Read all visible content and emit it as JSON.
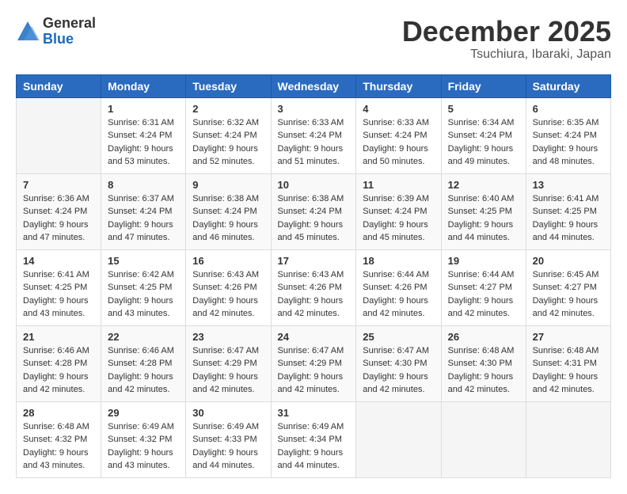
{
  "header": {
    "logo_general": "General",
    "logo_blue": "Blue",
    "month_title": "December 2025",
    "location": "Tsuchiura, Ibaraki, Japan"
  },
  "calendar": {
    "days_of_week": [
      "Sunday",
      "Monday",
      "Tuesday",
      "Wednesday",
      "Thursday",
      "Friday",
      "Saturday"
    ],
    "weeks": [
      [
        {
          "day": "",
          "info": ""
        },
        {
          "day": "1",
          "info": "Sunrise: 6:31 AM\nSunset: 4:24 PM\nDaylight: 9 hours\nand 53 minutes."
        },
        {
          "day": "2",
          "info": "Sunrise: 6:32 AM\nSunset: 4:24 PM\nDaylight: 9 hours\nand 52 minutes."
        },
        {
          "day": "3",
          "info": "Sunrise: 6:33 AM\nSunset: 4:24 PM\nDaylight: 9 hours\nand 51 minutes."
        },
        {
          "day": "4",
          "info": "Sunrise: 6:33 AM\nSunset: 4:24 PM\nDaylight: 9 hours\nand 50 minutes."
        },
        {
          "day": "5",
          "info": "Sunrise: 6:34 AM\nSunset: 4:24 PM\nDaylight: 9 hours\nand 49 minutes."
        },
        {
          "day": "6",
          "info": "Sunrise: 6:35 AM\nSunset: 4:24 PM\nDaylight: 9 hours\nand 48 minutes."
        }
      ],
      [
        {
          "day": "7",
          "info": "Sunrise: 6:36 AM\nSunset: 4:24 PM\nDaylight: 9 hours\nand 47 minutes."
        },
        {
          "day": "8",
          "info": "Sunrise: 6:37 AM\nSunset: 4:24 PM\nDaylight: 9 hours\nand 47 minutes."
        },
        {
          "day": "9",
          "info": "Sunrise: 6:38 AM\nSunset: 4:24 PM\nDaylight: 9 hours\nand 46 minutes."
        },
        {
          "day": "10",
          "info": "Sunrise: 6:38 AM\nSunset: 4:24 PM\nDaylight: 9 hours\nand 45 minutes."
        },
        {
          "day": "11",
          "info": "Sunrise: 6:39 AM\nSunset: 4:24 PM\nDaylight: 9 hours\nand 45 minutes."
        },
        {
          "day": "12",
          "info": "Sunrise: 6:40 AM\nSunset: 4:25 PM\nDaylight: 9 hours\nand 44 minutes."
        },
        {
          "day": "13",
          "info": "Sunrise: 6:41 AM\nSunset: 4:25 PM\nDaylight: 9 hours\nand 44 minutes."
        }
      ],
      [
        {
          "day": "14",
          "info": "Sunrise: 6:41 AM\nSunset: 4:25 PM\nDaylight: 9 hours\nand 43 minutes."
        },
        {
          "day": "15",
          "info": "Sunrise: 6:42 AM\nSunset: 4:25 PM\nDaylight: 9 hours\nand 43 minutes."
        },
        {
          "day": "16",
          "info": "Sunrise: 6:43 AM\nSunset: 4:26 PM\nDaylight: 9 hours\nand 42 minutes."
        },
        {
          "day": "17",
          "info": "Sunrise: 6:43 AM\nSunset: 4:26 PM\nDaylight: 9 hours\nand 42 minutes."
        },
        {
          "day": "18",
          "info": "Sunrise: 6:44 AM\nSunset: 4:26 PM\nDaylight: 9 hours\nand 42 minutes."
        },
        {
          "day": "19",
          "info": "Sunrise: 6:44 AM\nSunset: 4:27 PM\nDaylight: 9 hours\nand 42 minutes."
        },
        {
          "day": "20",
          "info": "Sunrise: 6:45 AM\nSunset: 4:27 PM\nDaylight: 9 hours\nand 42 minutes."
        }
      ],
      [
        {
          "day": "21",
          "info": "Sunrise: 6:46 AM\nSunset: 4:28 PM\nDaylight: 9 hours\nand 42 minutes."
        },
        {
          "day": "22",
          "info": "Sunrise: 6:46 AM\nSunset: 4:28 PM\nDaylight: 9 hours\nand 42 minutes."
        },
        {
          "day": "23",
          "info": "Sunrise: 6:47 AM\nSunset: 4:29 PM\nDaylight: 9 hours\nand 42 minutes."
        },
        {
          "day": "24",
          "info": "Sunrise: 6:47 AM\nSunset: 4:29 PM\nDaylight: 9 hours\nand 42 minutes."
        },
        {
          "day": "25",
          "info": "Sunrise: 6:47 AM\nSunset: 4:30 PM\nDaylight: 9 hours\nand 42 minutes."
        },
        {
          "day": "26",
          "info": "Sunrise: 6:48 AM\nSunset: 4:30 PM\nDaylight: 9 hours\nand 42 minutes."
        },
        {
          "day": "27",
          "info": "Sunrise: 6:48 AM\nSunset: 4:31 PM\nDaylight: 9 hours\nand 42 minutes."
        }
      ],
      [
        {
          "day": "28",
          "info": "Sunrise: 6:48 AM\nSunset: 4:32 PM\nDaylight: 9 hours\nand 43 minutes."
        },
        {
          "day": "29",
          "info": "Sunrise: 6:49 AM\nSunset: 4:32 PM\nDaylight: 9 hours\nand 43 minutes."
        },
        {
          "day": "30",
          "info": "Sunrise: 6:49 AM\nSunset: 4:33 PM\nDaylight: 9 hours\nand 44 minutes."
        },
        {
          "day": "31",
          "info": "Sunrise: 6:49 AM\nSunset: 4:34 PM\nDaylight: 9 hours\nand 44 minutes."
        },
        {
          "day": "",
          "info": ""
        },
        {
          "day": "",
          "info": ""
        },
        {
          "day": "",
          "info": ""
        }
      ]
    ]
  }
}
